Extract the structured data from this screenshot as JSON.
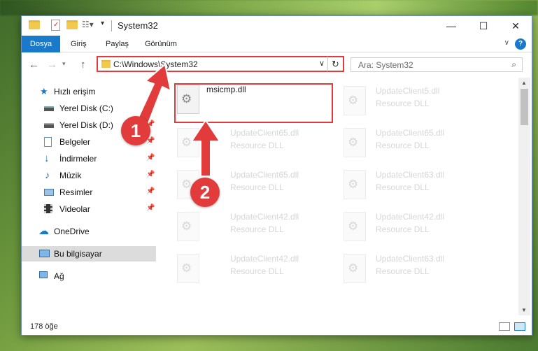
{
  "window": {
    "title": "System32"
  },
  "ribbon": {
    "tabs": [
      "Dosya",
      "Giriş",
      "Paylaş",
      "Görünüm"
    ]
  },
  "nav": {
    "address": "C:\\Windows\\System32",
    "search_placeholder": "Ara: System32"
  },
  "sidebar": {
    "items": [
      {
        "label": "Hızlı erişim",
        "icon": "star-icon"
      },
      {
        "label": "Yerel Disk (C:)",
        "icon": "drive-icon"
      },
      {
        "label": "Yerel Disk (D:)",
        "icon": "drive-icon"
      },
      {
        "label": "Belgeler",
        "icon": "documents-icon"
      },
      {
        "label": "İndirmeler",
        "icon": "download-icon"
      },
      {
        "label": "Müzik",
        "icon": "music-icon"
      },
      {
        "label": "Resimler",
        "icon": "pictures-icon"
      },
      {
        "label": "Videolar",
        "icon": "videos-icon"
      },
      {
        "label": "OneDrive",
        "icon": "cloud-icon"
      },
      {
        "label": "Bu bilgisayar",
        "icon": "computer-icon"
      },
      {
        "label": "Ağ",
        "icon": "network-icon"
      }
    ]
  },
  "files": [
    {
      "name": "msicmp.dll",
      "type": ""
    },
    {
      "name": "UpdateClient5.dll",
      "type": "Resource DLL"
    },
    {
      "name": "UpdateClient65.dll",
      "type": "Resource DLL"
    },
    {
      "name": "UpdateClient65.dll",
      "type": "Resource DLL"
    },
    {
      "name": "UpdateClient65.dll",
      "type": "Resource DLL"
    },
    {
      "name": "UpdateClient63.dll",
      "type": "Resource DLL"
    },
    {
      "name": "UpdateClient42.dll",
      "type": "Resource DLL"
    },
    {
      "name": "UpdateClient42.dll",
      "type": "Resource DLL"
    },
    {
      "name": "UpdateClient42.dll",
      "type": "Resource DLL"
    },
    {
      "name": "UpdateClient63.dll",
      "type": "Resource DLL"
    }
  ],
  "status": {
    "count": "178 öğe"
  },
  "annotations": {
    "step1": "1",
    "step2": "2"
  },
  "colors": {
    "accent": "#1979ca",
    "highlight": "#e23b3b"
  }
}
